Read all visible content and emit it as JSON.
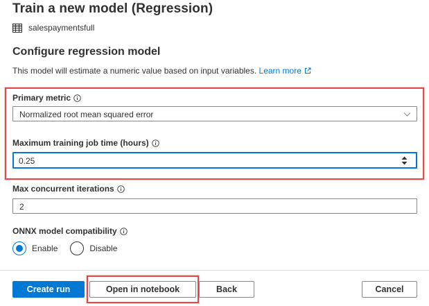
{
  "header": {
    "title": "Train a new model (Regression)",
    "dataset_icon": "table-icon",
    "dataset_name": "salespaymentsfull"
  },
  "configure": {
    "title": "Configure regression model",
    "description": "This model will estimate a numeric value based on input variables.",
    "learn_more": "Learn more",
    "learn_more_icon": "external-link-icon"
  },
  "fields": {
    "primary_metric": {
      "label": "Primary metric",
      "value": "Normalized root mean squared error"
    },
    "max_training_time": {
      "label": "Maximum training job time (hours)",
      "value": "0.25"
    },
    "max_concurrent": {
      "label": "Max concurrent iterations",
      "value": "2"
    },
    "onnx": {
      "label": "ONNX model compatibility",
      "options": [
        "Enable",
        "Disable"
      ],
      "selected": "Enable"
    }
  },
  "footer": {
    "create_run": "Create run",
    "open_notebook": "Open in notebook",
    "back": "Back",
    "cancel": "Cancel"
  },
  "colors": {
    "accent": "#0078d4",
    "highlight": "#e04a4a",
    "text": "#323130"
  }
}
